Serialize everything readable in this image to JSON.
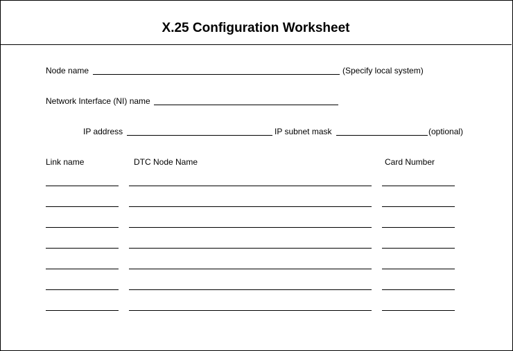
{
  "title": "X.25 Configuration Worksheet",
  "fields": {
    "node_name": {
      "label": "Node name",
      "note": "(Specify local system)",
      "value": ""
    },
    "ni_name": {
      "label": "Network Interface (NI) name",
      "value": ""
    },
    "ip_address": {
      "label": "IP address",
      "value": ""
    },
    "ip_subnet_mask": {
      "label": "IP subnet mask",
      "note": "(optional)",
      "value": ""
    }
  },
  "table": {
    "columns": [
      "Link name",
      "DTC Node Name",
      "Card Number"
    ],
    "rows": [
      {
        "link_name": "",
        "dtc_node_name": "",
        "card_number": ""
      },
      {
        "link_name": "",
        "dtc_node_name": "",
        "card_number": ""
      },
      {
        "link_name": "",
        "dtc_node_name": "",
        "card_number": ""
      },
      {
        "link_name": "",
        "dtc_node_name": "",
        "card_number": ""
      },
      {
        "link_name": "",
        "dtc_node_name": "",
        "card_number": ""
      },
      {
        "link_name": "",
        "dtc_node_name": "",
        "card_number": ""
      },
      {
        "link_name": "",
        "dtc_node_name": "",
        "card_number": ""
      }
    ]
  }
}
